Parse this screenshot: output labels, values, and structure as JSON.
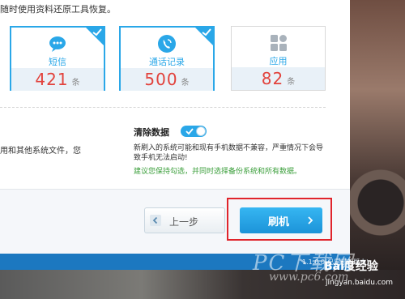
{
  "intro_text": "随时使用资料还原工具恢复。",
  "cards": [
    {
      "label": "短信",
      "count": "421",
      "unit": "条",
      "selected": true,
      "icon": "chat-bubble-icon"
    },
    {
      "label": "通话记录",
      "count": "500",
      "unit": "条",
      "selected": true,
      "icon": "phone-call-icon"
    },
    {
      "label": "应用",
      "count": "82",
      "unit": "条",
      "selected": false,
      "icon": "apps-grid-icon"
    }
  ],
  "left_note": "用和其他系统文件，您",
  "wipe": {
    "title": "清除数据",
    "enabled": true,
    "warning": "新刷入的系统可能和现有手机数据不兼容，严重情况下会导致手机无法启动!",
    "suggestion": "建议您保持勾选，并同时选择备份系统和所有数据。"
  },
  "buttons": {
    "back_label": "上一步",
    "flash_label": "刷机"
  },
  "status": {
    "version": "1.1.0.0(已是最新版本)"
  },
  "watermark": {
    "site_cn": "PC下载网",
    "url": "www.pc6.com",
    "logo": "Bai度经验",
    "logo_url": "jingyan.baidu.com"
  },
  "colors": {
    "accent": "#2aa7e8",
    "count": "#e2423c",
    "suggest": "#3a9e3a",
    "highlight": "#e0242b",
    "statusbar": "#1c78c0"
  }
}
